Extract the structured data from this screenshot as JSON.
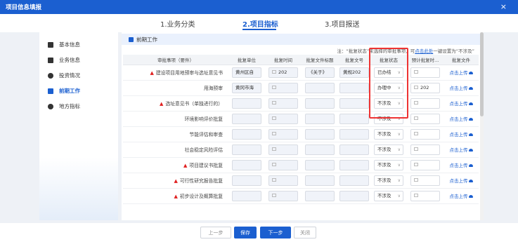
{
  "window": {
    "title": "项目信息填报",
    "close_glyph": "×"
  },
  "steps": [
    "1.业务分类",
    "2.项目指标",
    "3.项目报送"
  ],
  "sidebar": {
    "items": [
      {
        "label": "基本信息",
        "icon": "document-icon"
      },
      {
        "label": "业务信息",
        "icon": "folder-icon"
      },
      {
        "label": "投资情况",
        "icon": "money-bag-icon"
      },
      {
        "label": "前期工作",
        "icon": "briefcase-icon",
        "active": true
      },
      {
        "label": "地方指标",
        "icon": "compass-icon"
      }
    ]
  },
  "section": {
    "title": "前期工作"
  },
  "note": {
    "prefix": "注：“批复状态”未选择的审批事项，可",
    "link": "点击此处",
    "suffix": "一键设置为“不涉及”"
  },
  "table": {
    "headers": [
      "审批事项（要件）",
      "批复单位",
      "批复时间",
      "批复文件标题",
      "批复文号",
      "批复状态",
      "预计批复时...",
      "批复文件"
    ],
    "rows": [
      {
        "name": "建设项目用地预审与选址意见书",
        "required": true,
        "unit": "黄州区自",
        "time": "202",
        "doc_title": "《关于》",
        "doc_no": "黄规202",
        "status": "已办结",
        "expected": "",
        "file": "点击上传"
      },
      {
        "name": "用海预审",
        "required": false,
        "unit": "黄冈市海",
        "time": "",
        "doc_title": "",
        "doc_no": "",
        "status": "办理中",
        "expected": "202",
        "file": "点击上传"
      },
      {
        "name": "选址意见书（单独进行的）",
        "required": true,
        "unit": "",
        "time": "",
        "doc_title": "",
        "doc_no": "",
        "status": "不涉及",
        "expected": "",
        "file": "点击上传"
      },
      {
        "name": "环境影响评价批复",
        "required": false,
        "unit": "",
        "time": "",
        "doc_title": "",
        "doc_no": "",
        "status": "不涉及",
        "expected": "",
        "file": "点击上传"
      },
      {
        "name": "节能评估和审查",
        "required": false,
        "unit": "",
        "time": "",
        "doc_title": "",
        "doc_no": "",
        "status": "不涉及",
        "expected": "",
        "file": "点击上传"
      },
      {
        "name": "社会稳定风险评估",
        "required": false,
        "unit": "",
        "time": "",
        "doc_title": "",
        "doc_no": "",
        "status": "不涉及",
        "expected": "",
        "file": "点击上传"
      },
      {
        "name": "项目建议书批复",
        "required": true,
        "unit": "",
        "time": "",
        "doc_title": "",
        "doc_no": "",
        "status": "不涉及",
        "expected": "",
        "file": "点击上传"
      },
      {
        "name": "可行性研究报告批复",
        "required": true,
        "unit": "",
        "time": "",
        "doc_title": "",
        "doc_no": "",
        "status": "不涉及",
        "expected": "",
        "file": "点击上传"
      },
      {
        "name": "初步设计及概算批复",
        "required": true,
        "unit": "",
        "time": "",
        "doc_title": "",
        "doc_no": "",
        "status": "不涉及",
        "expected": "",
        "file": "点击上传"
      }
    ]
  },
  "footer": {
    "prev": "上一步",
    "save": "保存",
    "next": "下一步",
    "close": "关闭"
  },
  "colors": {
    "primary": "#1b5fd0",
    "highlight_box": "#e33333",
    "required_marker": "#e02020"
  }
}
